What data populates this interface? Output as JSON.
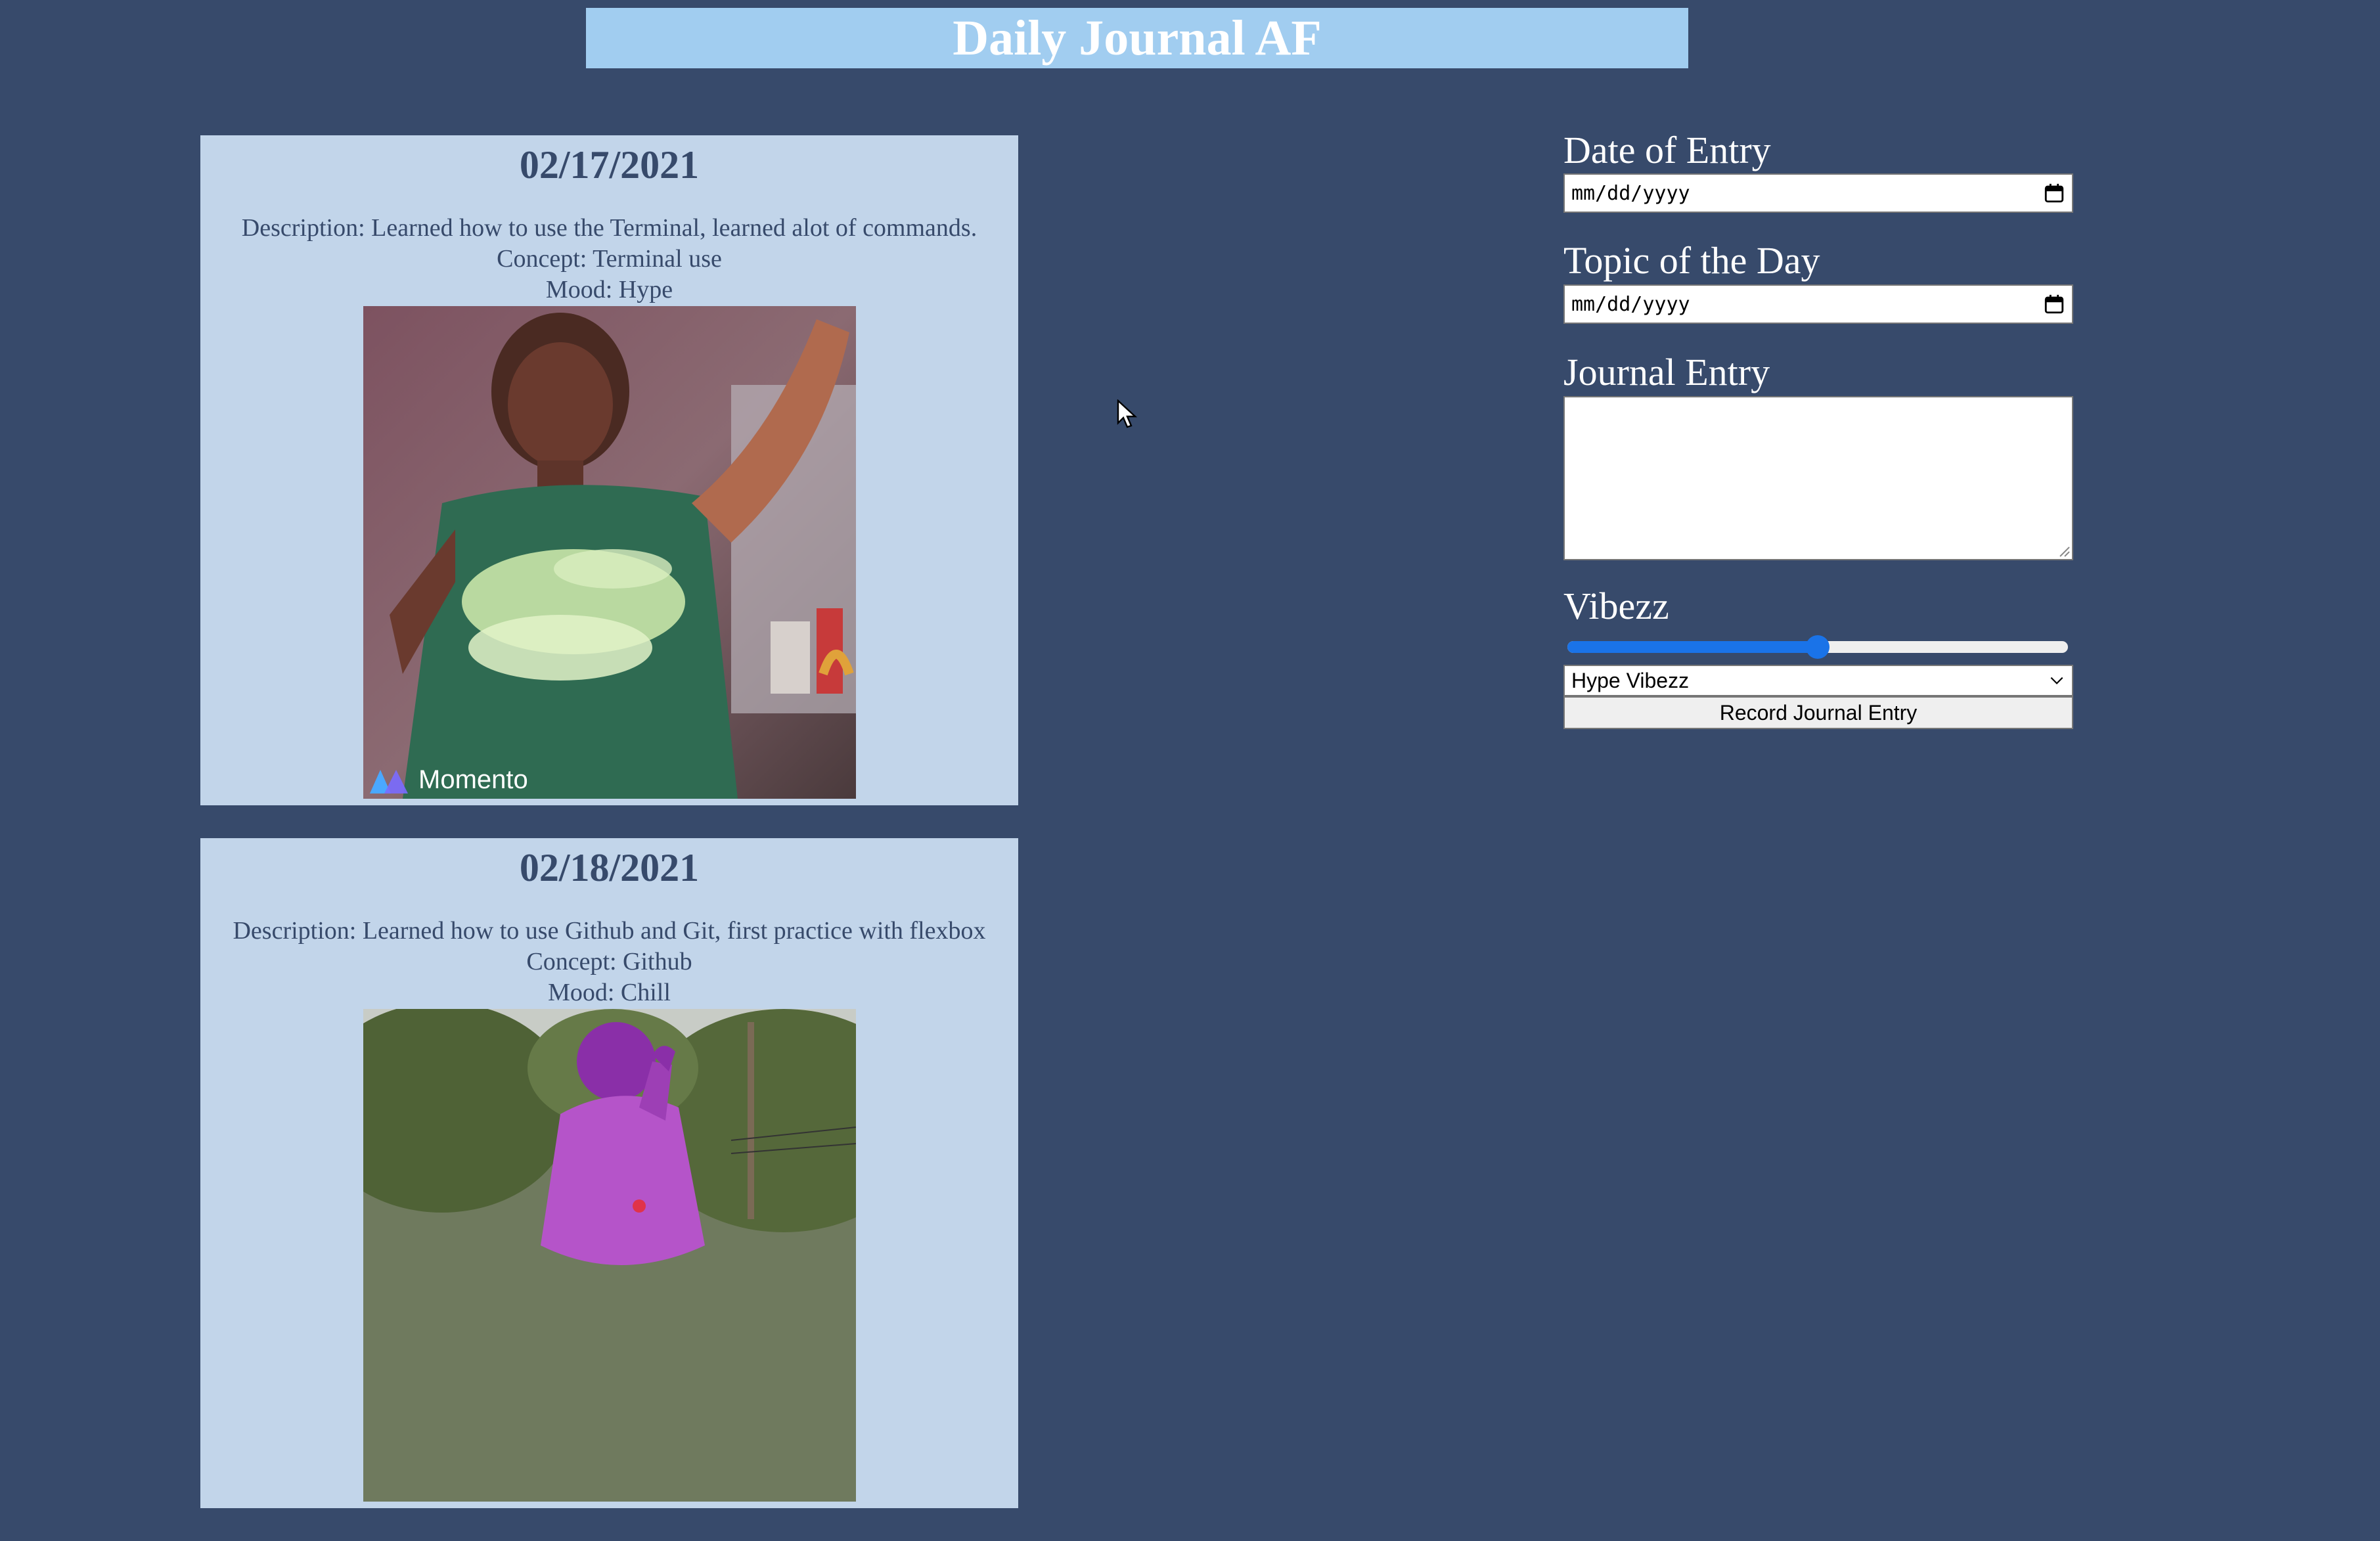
{
  "app": {
    "title": "Daily Journal AF"
  },
  "entries": [
    {
      "date": "02/17/2021",
      "description": "Description: Learned how to use the Terminal, learned alot of commands.",
      "concept": "Concept: Terminal use",
      "mood": "Mood: Hype",
      "gif": {
        "subject": "person-dancing",
        "watermark": "Momento"
      }
    },
    {
      "date": "02/18/2021",
      "description": "Description: Learned how to use Github and Git, first practice with flexbox",
      "concept": "Concept: Github",
      "mood": "Mood: Chill",
      "gif": {
        "subject": "inflatable-costume-outdoors"
      }
    }
  ],
  "form": {
    "date_label": "Date of Entry",
    "date_placeholder": "mm/dd/yyyy",
    "topic_label": "Topic of the Day",
    "topic_placeholder": "mm/dd/yyyy",
    "journal_label": "Journal Entry",
    "journal_value": "",
    "vibes_label": "Vibezz",
    "vibes_level": 0.5,
    "mood_selected": "Hype Vibezz",
    "record_label": "Record Journal Entry"
  },
  "icons": {
    "calendar": "calendar-icon",
    "chevron": "chevron-down-icon",
    "cursor": "mouse-pointer-icon",
    "watermark_logo": "momento-logo-icon"
  },
  "colors": {
    "background": "#374a6b",
    "header": "#a1cdf0",
    "card": "#c2d5ea",
    "card_text": "#374a6b",
    "slider_accent": "#1a73e8"
  }
}
